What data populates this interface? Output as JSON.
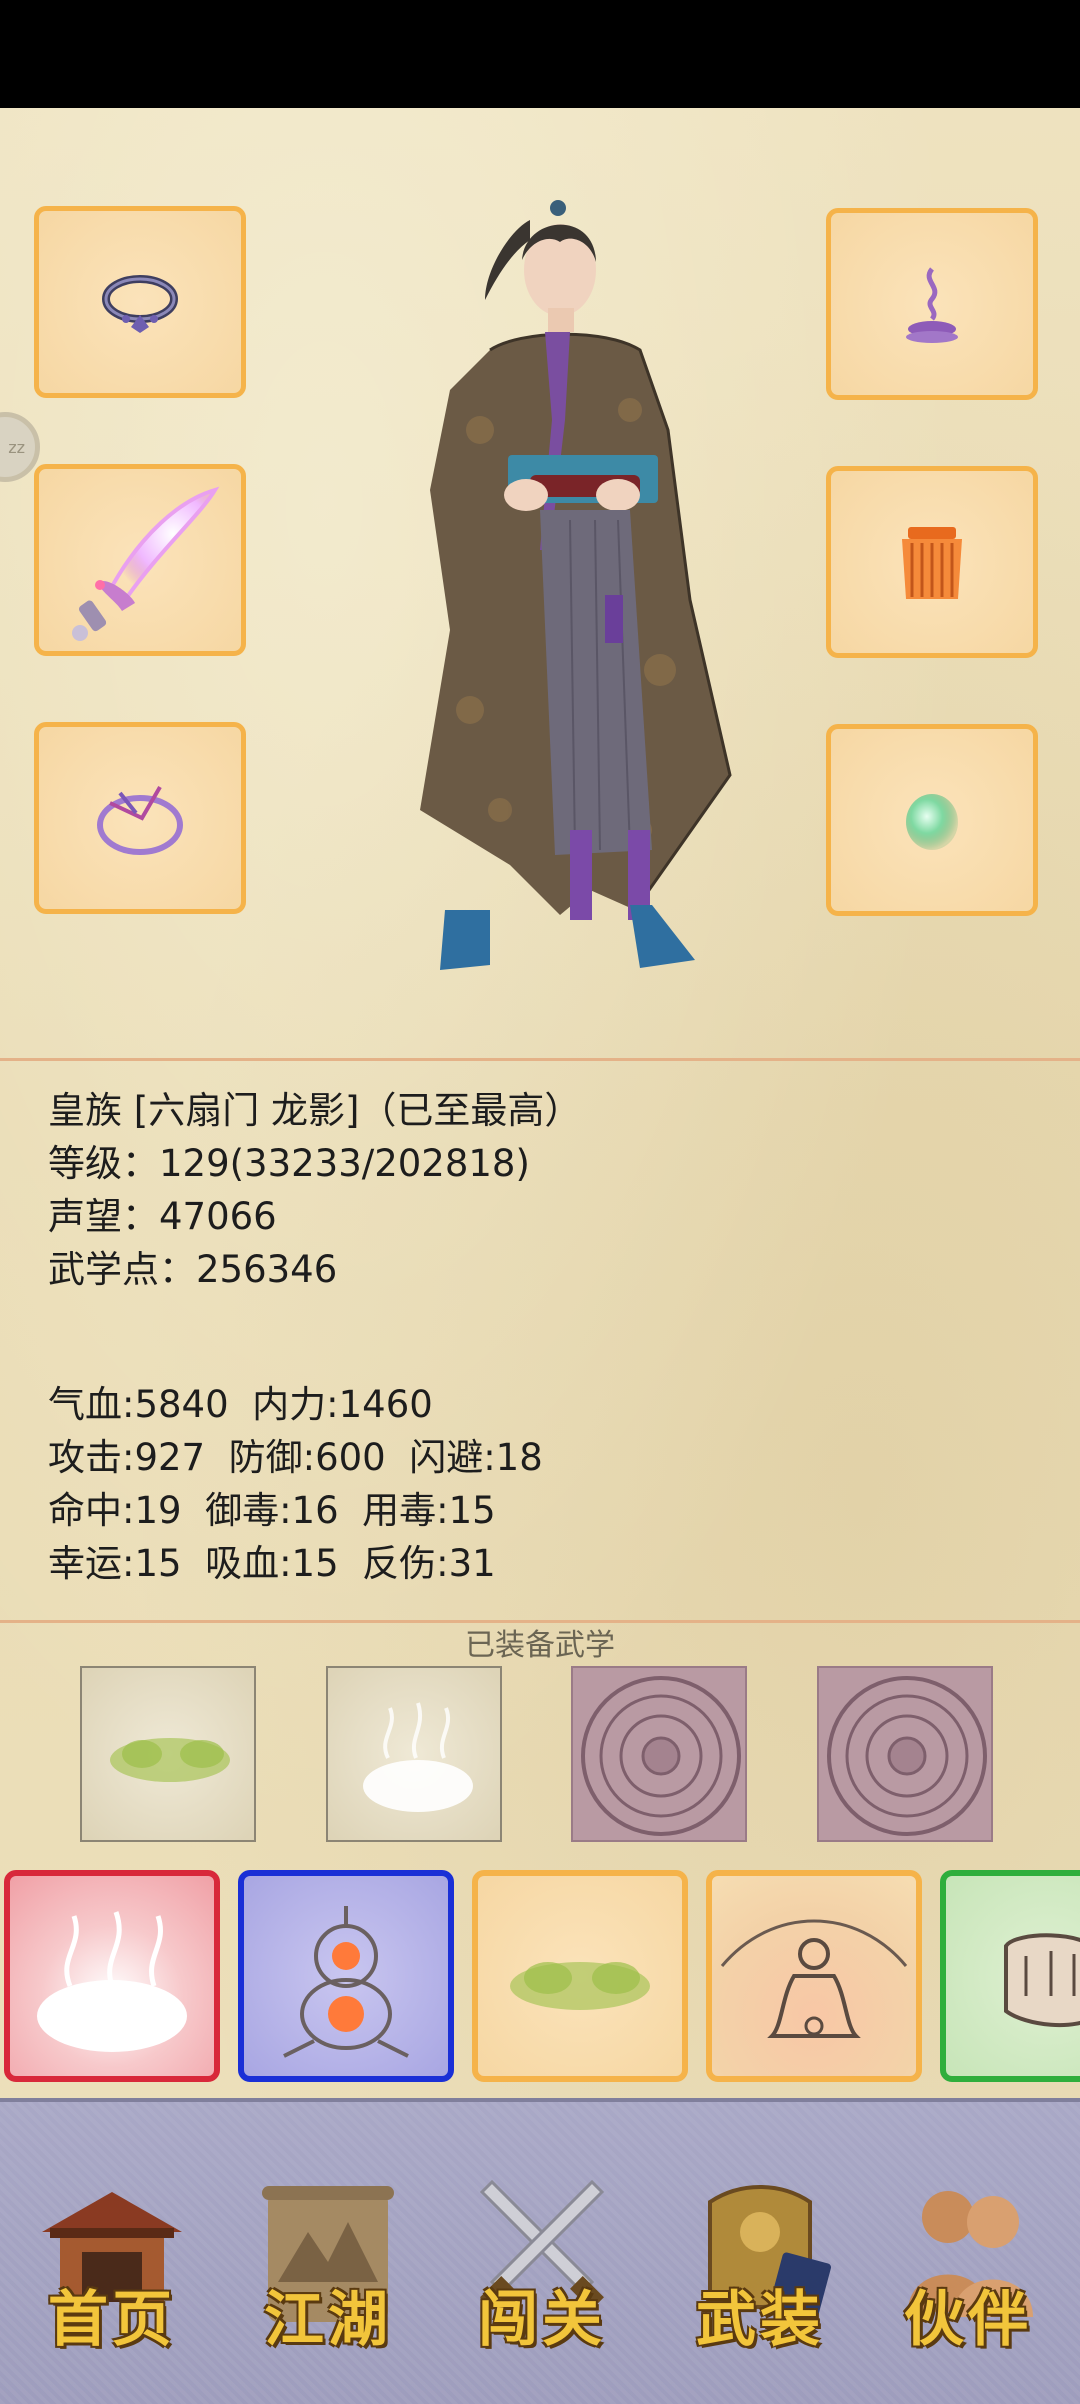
{
  "character": {
    "title_line": "皇族 [六扇门 龙影]（已至最高）",
    "level_line": "等级：129(33233/202818)",
    "reputation_line": "声望：47066",
    "martial_points_line": "武学点：256346"
  },
  "stats": {
    "row1": "气血:5840  内力:1460",
    "row2": "攻击:927  防御:600  闪避:18",
    "row3": "命中:19  御毒:16  用毒:15",
    "row4": "幸运:15  吸血:15  反伤:31"
  },
  "equipped_martial": {
    "title": "已装备武学"
  },
  "side_tab": {
    "label": "zz"
  },
  "equipment_slots": {
    "left": [
      "bracelet-icon",
      "sword-icon",
      "ring-icon"
    ],
    "right": [
      "incense-icon",
      "armor-icon",
      "jade-icon"
    ]
  },
  "skill_borders": [
    "#d8283a",
    "#1a2fd6",
    "#f5b34a",
    "#f5b34a",
    "#2fae3c"
  ],
  "nav": {
    "home": "首页",
    "jianghu": "江湖",
    "chuangguan": "闯关",
    "wuzhuang": "武装",
    "huoban": "伙伴"
  }
}
